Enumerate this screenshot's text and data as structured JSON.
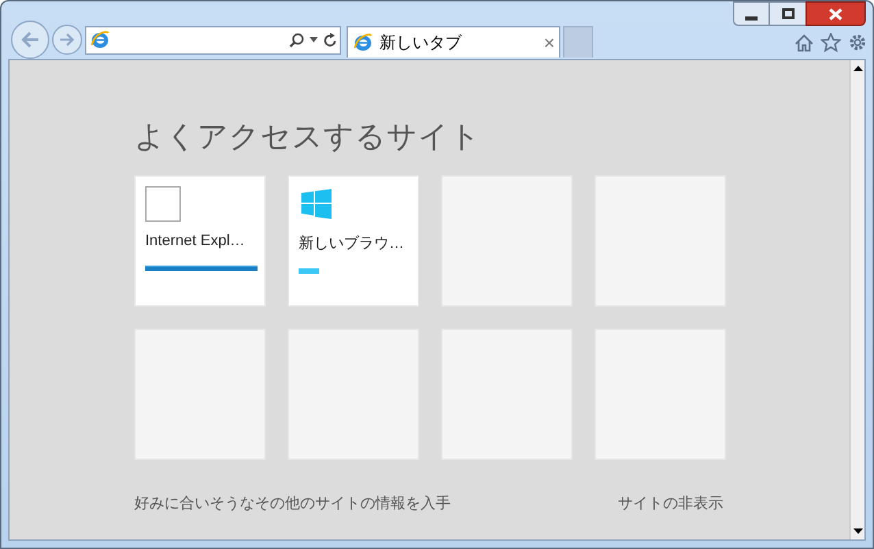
{
  "toolbar": {
    "tabs": [
      {
        "label": "新しいタブ",
        "selected": true,
        "close": "×"
      }
    ]
  },
  "page": {
    "heading": "よくアクセスするサイト",
    "tiles": [
      {
        "kind": "page",
        "title": "Internet Expl…",
        "level": 1
      },
      {
        "kind": "app",
        "title": "新しいブラウ…",
        "level": 0.18
      },
      {
        "kind": "empty"
      },
      {
        "kind": "empty"
      },
      {
        "kind": "empty"
      },
      {
        "kind": "empty"
      },
      {
        "kind": "empty"
      },
      {
        "kind": "empty"
      }
    ],
    "footer": {
      "left": "好みに合いそうなその他のサイトの情報を入手",
      "right": "サイトの非表示"
    }
  }
}
